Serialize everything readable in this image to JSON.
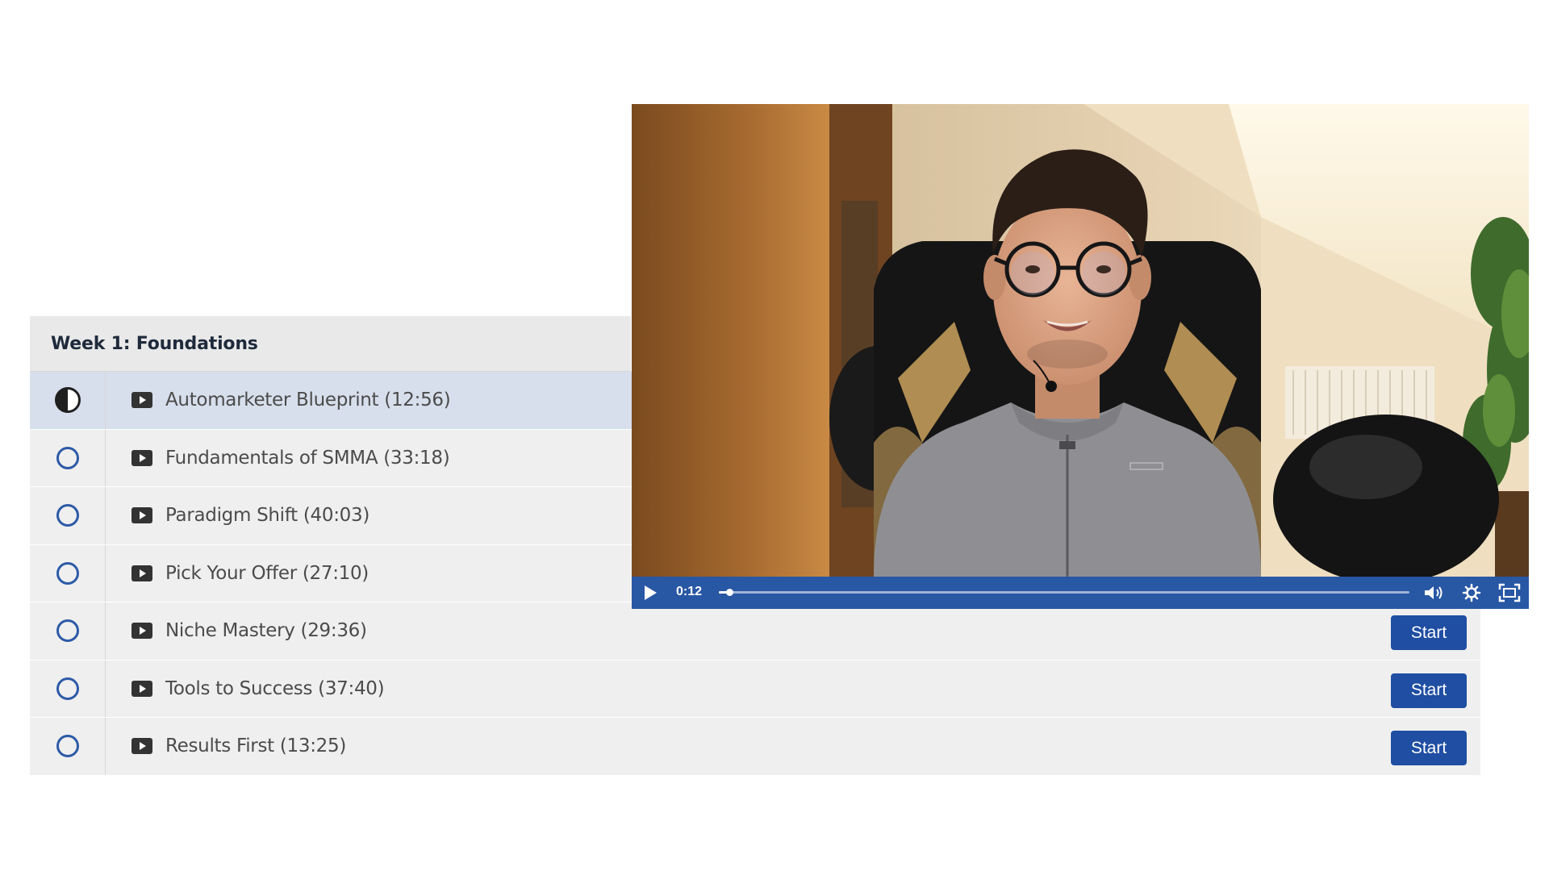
{
  "section": {
    "title": "Week 1: Foundations"
  },
  "lectures": [
    {
      "title": "Automarketer Blueprint (12:56)",
      "status": "in-progress",
      "button": ""
    },
    {
      "title": "Fundamentals of SMMA (33:18)",
      "status": "not-started",
      "button": ""
    },
    {
      "title": "Paradigm Shift (40:03)",
      "status": "not-started",
      "button": ""
    },
    {
      "title": "Pick Your Offer (27:10)",
      "status": "not-started",
      "button": ""
    },
    {
      "title": "Niche Mastery (29:36)",
      "status": "not-started",
      "button": "Start"
    },
    {
      "title": "Tools to Success (37:40)",
      "status": "not-started",
      "button": "Start"
    },
    {
      "title": "Results First (13:25)",
      "status": "not-started",
      "button": "Start"
    }
  ],
  "player": {
    "current_time": "0:12",
    "progress_fraction": 0.015,
    "icons": [
      "play-icon",
      "volume-icon",
      "settings-gear-icon",
      "fullscreen-icon"
    ]
  },
  "colors": {
    "accent": "#2857a4",
    "button": "#1f4ea2",
    "active_row": "#d8dfec",
    "row": "#efefef",
    "header": "#e9e9e9"
  }
}
